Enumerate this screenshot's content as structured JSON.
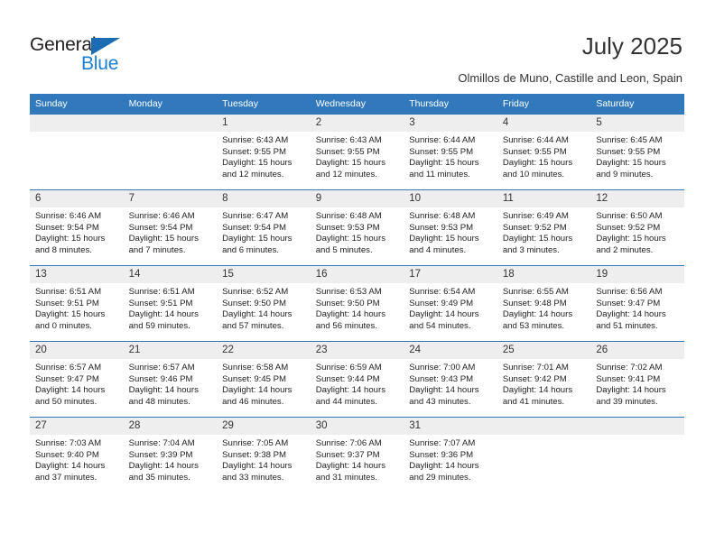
{
  "brand": {
    "name_top": "General",
    "name_bottom": "Blue",
    "triangle_icon": "brand-triangle-icon",
    "color_dark": "#231f20",
    "color_blue": "#1b7fd4",
    "triangle_color": "#1b6cb3"
  },
  "header": {
    "title": "July 2025",
    "subtitle": "Olmillos de Muno, Castille and Leon, Spain"
  },
  "theme": {
    "header_row_bg": "#3179bc",
    "header_row_text": "#ffffff",
    "daynum_bg": "#eeeeee",
    "row_border": "#3179bc",
    "body_text": "#222222"
  },
  "calendar": {
    "weekday_headers": [
      "Sunday",
      "Monday",
      "Tuesday",
      "Wednesday",
      "Thursday",
      "Friday",
      "Saturday"
    ],
    "weeks": [
      [
        {
          "day": "",
          "lines": []
        },
        {
          "day": "",
          "lines": []
        },
        {
          "day": "1",
          "lines": [
            "Sunrise: 6:43 AM",
            "Sunset: 9:55 PM",
            "Daylight: 15 hours",
            "and 12 minutes."
          ]
        },
        {
          "day": "2",
          "lines": [
            "Sunrise: 6:43 AM",
            "Sunset: 9:55 PM",
            "Daylight: 15 hours",
            "and 12 minutes."
          ]
        },
        {
          "day": "3",
          "lines": [
            "Sunrise: 6:44 AM",
            "Sunset: 9:55 PM",
            "Daylight: 15 hours",
            "and 11 minutes."
          ]
        },
        {
          "day": "4",
          "lines": [
            "Sunrise: 6:44 AM",
            "Sunset: 9:55 PM",
            "Daylight: 15 hours",
            "and 10 minutes."
          ]
        },
        {
          "day": "5",
          "lines": [
            "Sunrise: 6:45 AM",
            "Sunset: 9:55 PM",
            "Daylight: 15 hours",
            "and 9 minutes."
          ]
        }
      ],
      [
        {
          "day": "6",
          "lines": [
            "Sunrise: 6:46 AM",
            "Sunset: 9:54 PM",
            "Daylight: 15 hours",
            "and 8 minutes."
          ]
        },
        {
          "day": "7",
          "lines": [
            "Sunrise: 6:46 AM",
            "Sunset: 9:54 PM",
            "Daylight: 15 hours",
            "and 7 minutes."
          ]
        },
        {
          "day": "8",
          "lines": [
            "Sunrise: 6:47 AM",
            "Sunset: 9:54 PM",
            "Daylight: 15 hours",
            "and 6 minutes."
          ]
        },
        {
          "day": "9",
          "lines": [
            "Sunrise: 6:48 AM",
            "Sunset: 9:53 PM",
            "Daylight: 15 hours",
            "and 5 minutes."
          ]
        },
        {
          "day": "10",
          "lines": [
            "Sunrise: 6:48 AM",
            "Sunset: 9:53 PM",
            "Daylight: 15 hours",
            "and 4 minutes."
          ]
        },
        {
          "day": "11",
          "lines": [
            "Sunrise: 6:49 AM",
            "Sunset: 9:52 PM",
            "Daylight: 15 hours",
            "and 3 minutes."
          ]
        },
        {
          "day": "12",
          "lines": [
            "Sunrise: 6:50 AM",
            "Sunset: 9:52 PM",
            "Daylight: 15 hours",
            "and 2 minutes."
          ]
        }
      ],
      [
        {
          "day": "13",
          "lines": [
            "Sunrise: 6:51 AM",
            "Sunset: 9:51 PM",
            "Daylight: 15 hours",
            "and 0 minutes."
          ]
        },
        {
          "day": "14",
          "lines": [
            "Sunrise: 6:51 AM",
            "Sunset: 9:51 PM",
            "Daylight: 14 hours",
            "and 59 minutes."
          ]
        },
        {
          "day": "15",
          "lines": [
            "Sunrise: 6:52 AM",
            "Sunset: 9:50 PM",
            "Daylight: 14 hours",
            "and 57 minutes."
          ]
        },
        {
          "day": "16",
          "lines": [
            "Sunrise: 6:53 AM",
            "Sunset: 9:50 PM",
            "Daylight: 14 hours",
            "and 56 minutes."
          ]
        },
        {
          "day": "17",
          "lines": [
            "Sunrise: 6:54 AM",
            "Sunset: 9:49 PM",
            "Daylight: 14 hours",
            "and 54 minutes."
          ]
        },
        {
          "day": "18",
          "lines": [
            "Sunrise: 6:55 AM",
            "Sunset: 9:48 PM",
            "Daylight: 14 hours",
            "and 53 minutes."
          ]
        },
        {
          "day": "19",
          "lines": [
            "Sunrise: 6:56 AM",
            "Sunset: 9:47 PM",
            "Daylight: 14 hours",
            "and 51 minutes."
          ]
        }
      ],
      [
        {
          "day": "20",
          "lines": [
            "Sunrise: 6:57 AM",
            "Sunset: 9:47 PM",
            "Daylight: 14 hours",
            "and 50 minutes."
          ]
        },
        {
          "day": "21",
          "lines": [
            "Sunrise: 6:57 AM",
            "Sunset: 9:46 PM",
            "Daylight: 14 hours",
            "and 48 minutes."
          ]
        },
        {
          "day": "22",
          "lines": [
            "Sunrise: 6:58 AM",
            "Sunset: 9:45 PM",
            "Daylight: 14 hours",
            "and 46 minutes."
          ]
        },
        {
          "day": "23",
          "lines": [
            "Sunrise: 6:59 AM",
            "Sunset: 9:44 PM",
            "Daylight: 14 hours",
            "and 44 minutes."
          ]
        },
        {
          "day": "24",
          "lines": [
            "Sunrise: 7:00 AM",
            "Sunset: 9:43 PM",
            "Daylight: 14 hours",
            "and 43 minutes."
          ]
        },
        {
          "day": "25",
          "lines": [
            "Sunrise: 7:01 AM",
            "Sunset: 9:42 PM",
            "Daylight: 14 hours",
            "and 41 minutes."
          ]
        },
        {
          "day": "26",
          "lines": [
            "Sunrise: 7:02 AM",
            "Sunset: 9:41 PM",
            "Daylight: 14 hours",
            "and 39 minutes."
          ]
        }
      ],
      [
        {
          "day": "27",
          "lines": [
            "Sunrise: 7:03 AM",
            "Sunset: 9:40 PM",
            "Daylight: 14 hours",
            "and 37 minutes."
          ]
        },
        {
          "day": "28",
          "lines": [
            "Sunrise: 7:04 AM",
            "Sunset: 9:39 PM",
            "Daylight: 14 hours",
            "and 35 minutes."
          ]
        },
        {
          "day": "29",
          "lines": [
            "Sunrise: 7:05 AM",
            "Sunset: 9:38 PM",
            "Daylight: 14 hours",
            "and 33 minutes."
          ]
        },
        {
          "day": "30",
          "lines": [
            "Sunrise: 7:06 AM",
            "Sunset: 9:37 PM",
            "Daylight: 14 hours",
            "and 31 minutes."
          ]
        },
        {
          "day": "31",
          "lines": [
            "Sunrise: 7:07 AM",
            "Sunset: 9:36 PM",
            "Daylight: 14 hours",
            "and 29 minutes."
          ]
        },
        {
          "day": "",
          "lines": []
        },
        {
          "day": "",
          "lines": []
        }
      ]
    ]
  }
}
